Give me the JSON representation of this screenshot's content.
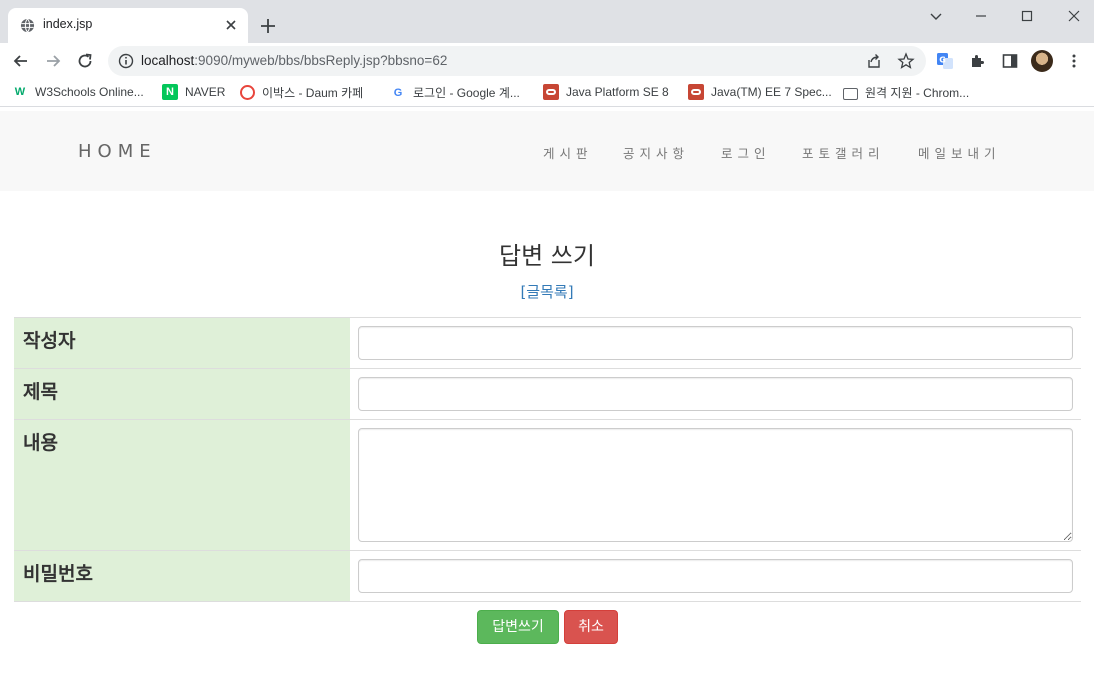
{
  "browser": {
    "tab_title": "index.jsp",
    "url_host": "localhost",
    "url_rest": ":9090/myweb/bbs/bbsReply.jsp?bbsno=62",
    "bookmarks": [
      {
        "label": "W3Schools Online...",
        "icon": "w3schools-icon",
        "color": "#04aa6d"
      },
      {
        "label": "NAVER",
        "icon": "naver-icon",
        "color": "#03c75a"
      },
      {
        "label": "이박스 - Daum 카페",
        "icon": "daum-icon",
        "color": "#e8453c"
      },
      {
        "label": "로그인 - Google 계...",
        "icon": "google-icon",
        "color": "#4285f4"
      },
      {
        "label": "Java Platform SE 8",
        "icon": "oracle-icon",
        "color": "#c74634"
      },
      {
        "label": "Java(TM) EE 7 Spec...",
        "icon": "oracle-icon",
        "color": "#c74634"
      },
      {
        "label": "원격 지원 - Chrom...",
        "icon": "remote-desktop-icon",
        "color": "#5f6368"
      }
    ]
  },
  "site": {
    "brand": "HOME",
    "menu": [
      "게시판",
      "공지사항",
      "로그인",
      "포토갤러리",
      "메일보내기"
    ]
  },
  "form": {
    "title": "답변 쓰기",
    "back_link": "[글목록]",
    "fields": {
      "writer_label": "작성자",
      "subject_label": "제목",
      "content_label": "내용",
      "password_label": "비밀번호"
    },
    "submit_label": "답변쓰기",
    "cancel_label": "취소"
  },
  "colors": {
    "label_bg": "#dff0d8",
    "success": "#5cb85c",
    "danger": "#d9534f",
    "link": "#337ab7"
  }
}
